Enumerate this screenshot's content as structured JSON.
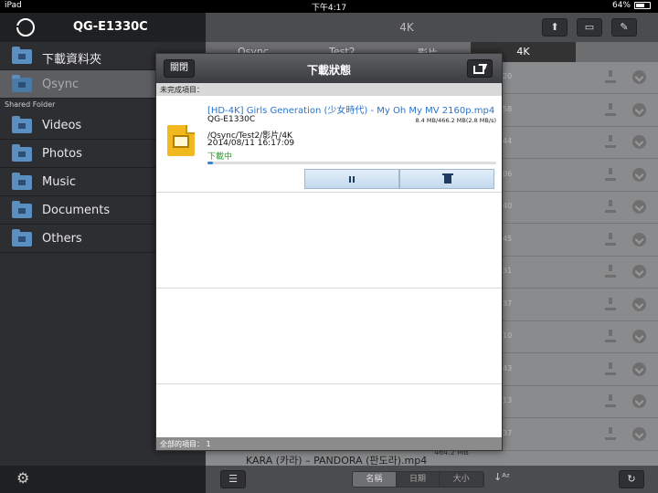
{
  "status_bar": {
    "device": "iPad",
    "time": "下午4:17",
    "battery": "64%",
    "battery_level": 0.64
  },
  "sidebar": {
    "title": "QG-E1330C",
    "items": [
      {
        "label": "下載資料夾"
      },
      {
        "label": "Qsync"
      }
    ],
    "section_label": "Shared Folder",
    "shared": [
      {
        "label": "Videos"
      },
      {
        "label": "Photos"
      },
      {
        "label": "Music"
      },
      {
        "label": "Documents"
      },
      {
        "label": "Others"
      }
    ]
  },
  "main": {
    "title": "4K",
    "breadcrumbs": [
      "Qsync",
      "Test2",
      "影片",
      "4K"
    ],
    "row_times": [
      "20",
      "58",
      "44",
      "06",
      "40",
      "45",
      "31",
      "37",
      "10",
      "43",
      "13",
      "37"
    ],
    "bottom_file": {
      "name": "KARA (카라) – PANDORA (판도라).mp4",
      "size": "464.2 MB"
    },
    "sort_options": [
      "名稱",
      "日期",
      "大小"
    ]
  },
  "dialog": {
    "title": "下載狀態",
    "close_label": "關閉",
    "incomplete_label": "未完成項目：",
    "task": {
      "name": "[HD-4K] Girls  Generation (少女時代) - My Oh My MV 2160p.mp4",
      "host": "QG-E1330C",
      "size_progress": "8.4 MB/466.2 MB(2.8 MB/s)",
      "path": "/Qsync/Test2/影片/4K",
      "datetime": "2014/08/11 16:17:09",
      "state": "下載中",
      "progress": 0.018
    },
    "footer": "全部的項目：  1"
  }
}
